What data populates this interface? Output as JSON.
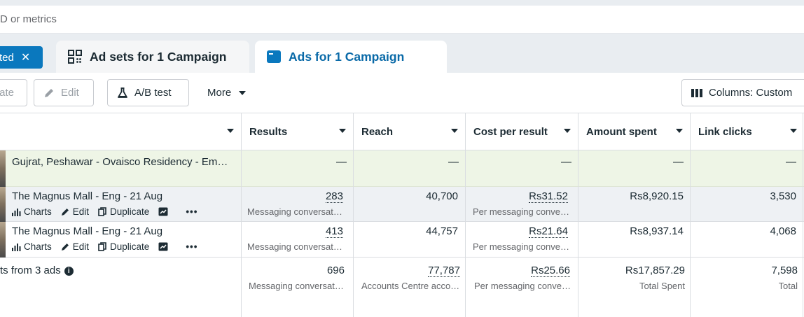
{
  "search": {
    "placeholder": "D or metrics"
  },
  "filter_chip": {
    "label": "ted",
    "close": "✕"
  },
  "tabs": [
    {
      "label": "Ad sets for 1 Campaign",
      "icon": "grid-icon",
      "active": false
    },
    {
      "label": "Ads for 1 Campaign",
      "icon": "ad-window-icon",
      "active": true
    }
  ],
  "toolbar": {
    "create_label": "ate",
    "edit_label": "Edit",
    "ab_test_label": "A/B test",
    "more_label": "More",
    "columns_label": "Columns: Custom"
  },
  "columns": [
    "Results",
    "Reach",
    "Cost per result",
    "Amount spent",
    "Link clicks"
  ],
  "campaign_row": {
    "name": "Gujrat, Peshawar - Ovaisco Residency - Em…",
    "dash": "—"
  },
  "ads": [
    {
      "name": "The Magnus Mall - Eng - 21 Aug",
      "results": "283",
      "results_sub": "Messaging conversat…",
      "reach": "40,700",
      "cost_per_result": "Rs31.52",
      "cost_sub": "Per messaging conve…",
      "amount_spent": "Rs8,920.15",
      "link_clicks": "3,530"
    },
    {
      "name": "The Magnus Mall - Eng - 21 Aug",
      "results": "413",
      "results_sub": "Messaging conversat…",
      "reach": "44,757",
      "cost_per_result": "Rs21.64",
      "cost_sub": "Per messaging conve…",
      "amount_spent": "Rs8,937.14",
      "link_clicks": "4,068"
    }
  ],
  "row_actions": {
    "charts": "Charts",
    "edit": "Edit",
    "duplicate": "Duplicate",
    "more": "•••"
  },
  "totals": {
    "label": "ts from 3 ads",
    "results": "696",
    "results_sub": "Messaging conversat…",
    "reach": "77,787",
    "reach_sub": "Accounts Centre acco…",
    "cost_per_result": "Rs25.66",
    "cost_sub": "Per messaging conve…",
    "amount_spent": "Rs17,857.29",
    "amount_sub": "Total Spent",
    "link_clicks": "7,598",
    "link_sub": "Total"
  },
  "colors": {
    "primary": "#0a78be",
    "campaign_row_bg": "#eef5e6",
    "hover_row_bg": "#eef1f4"
  }
}
